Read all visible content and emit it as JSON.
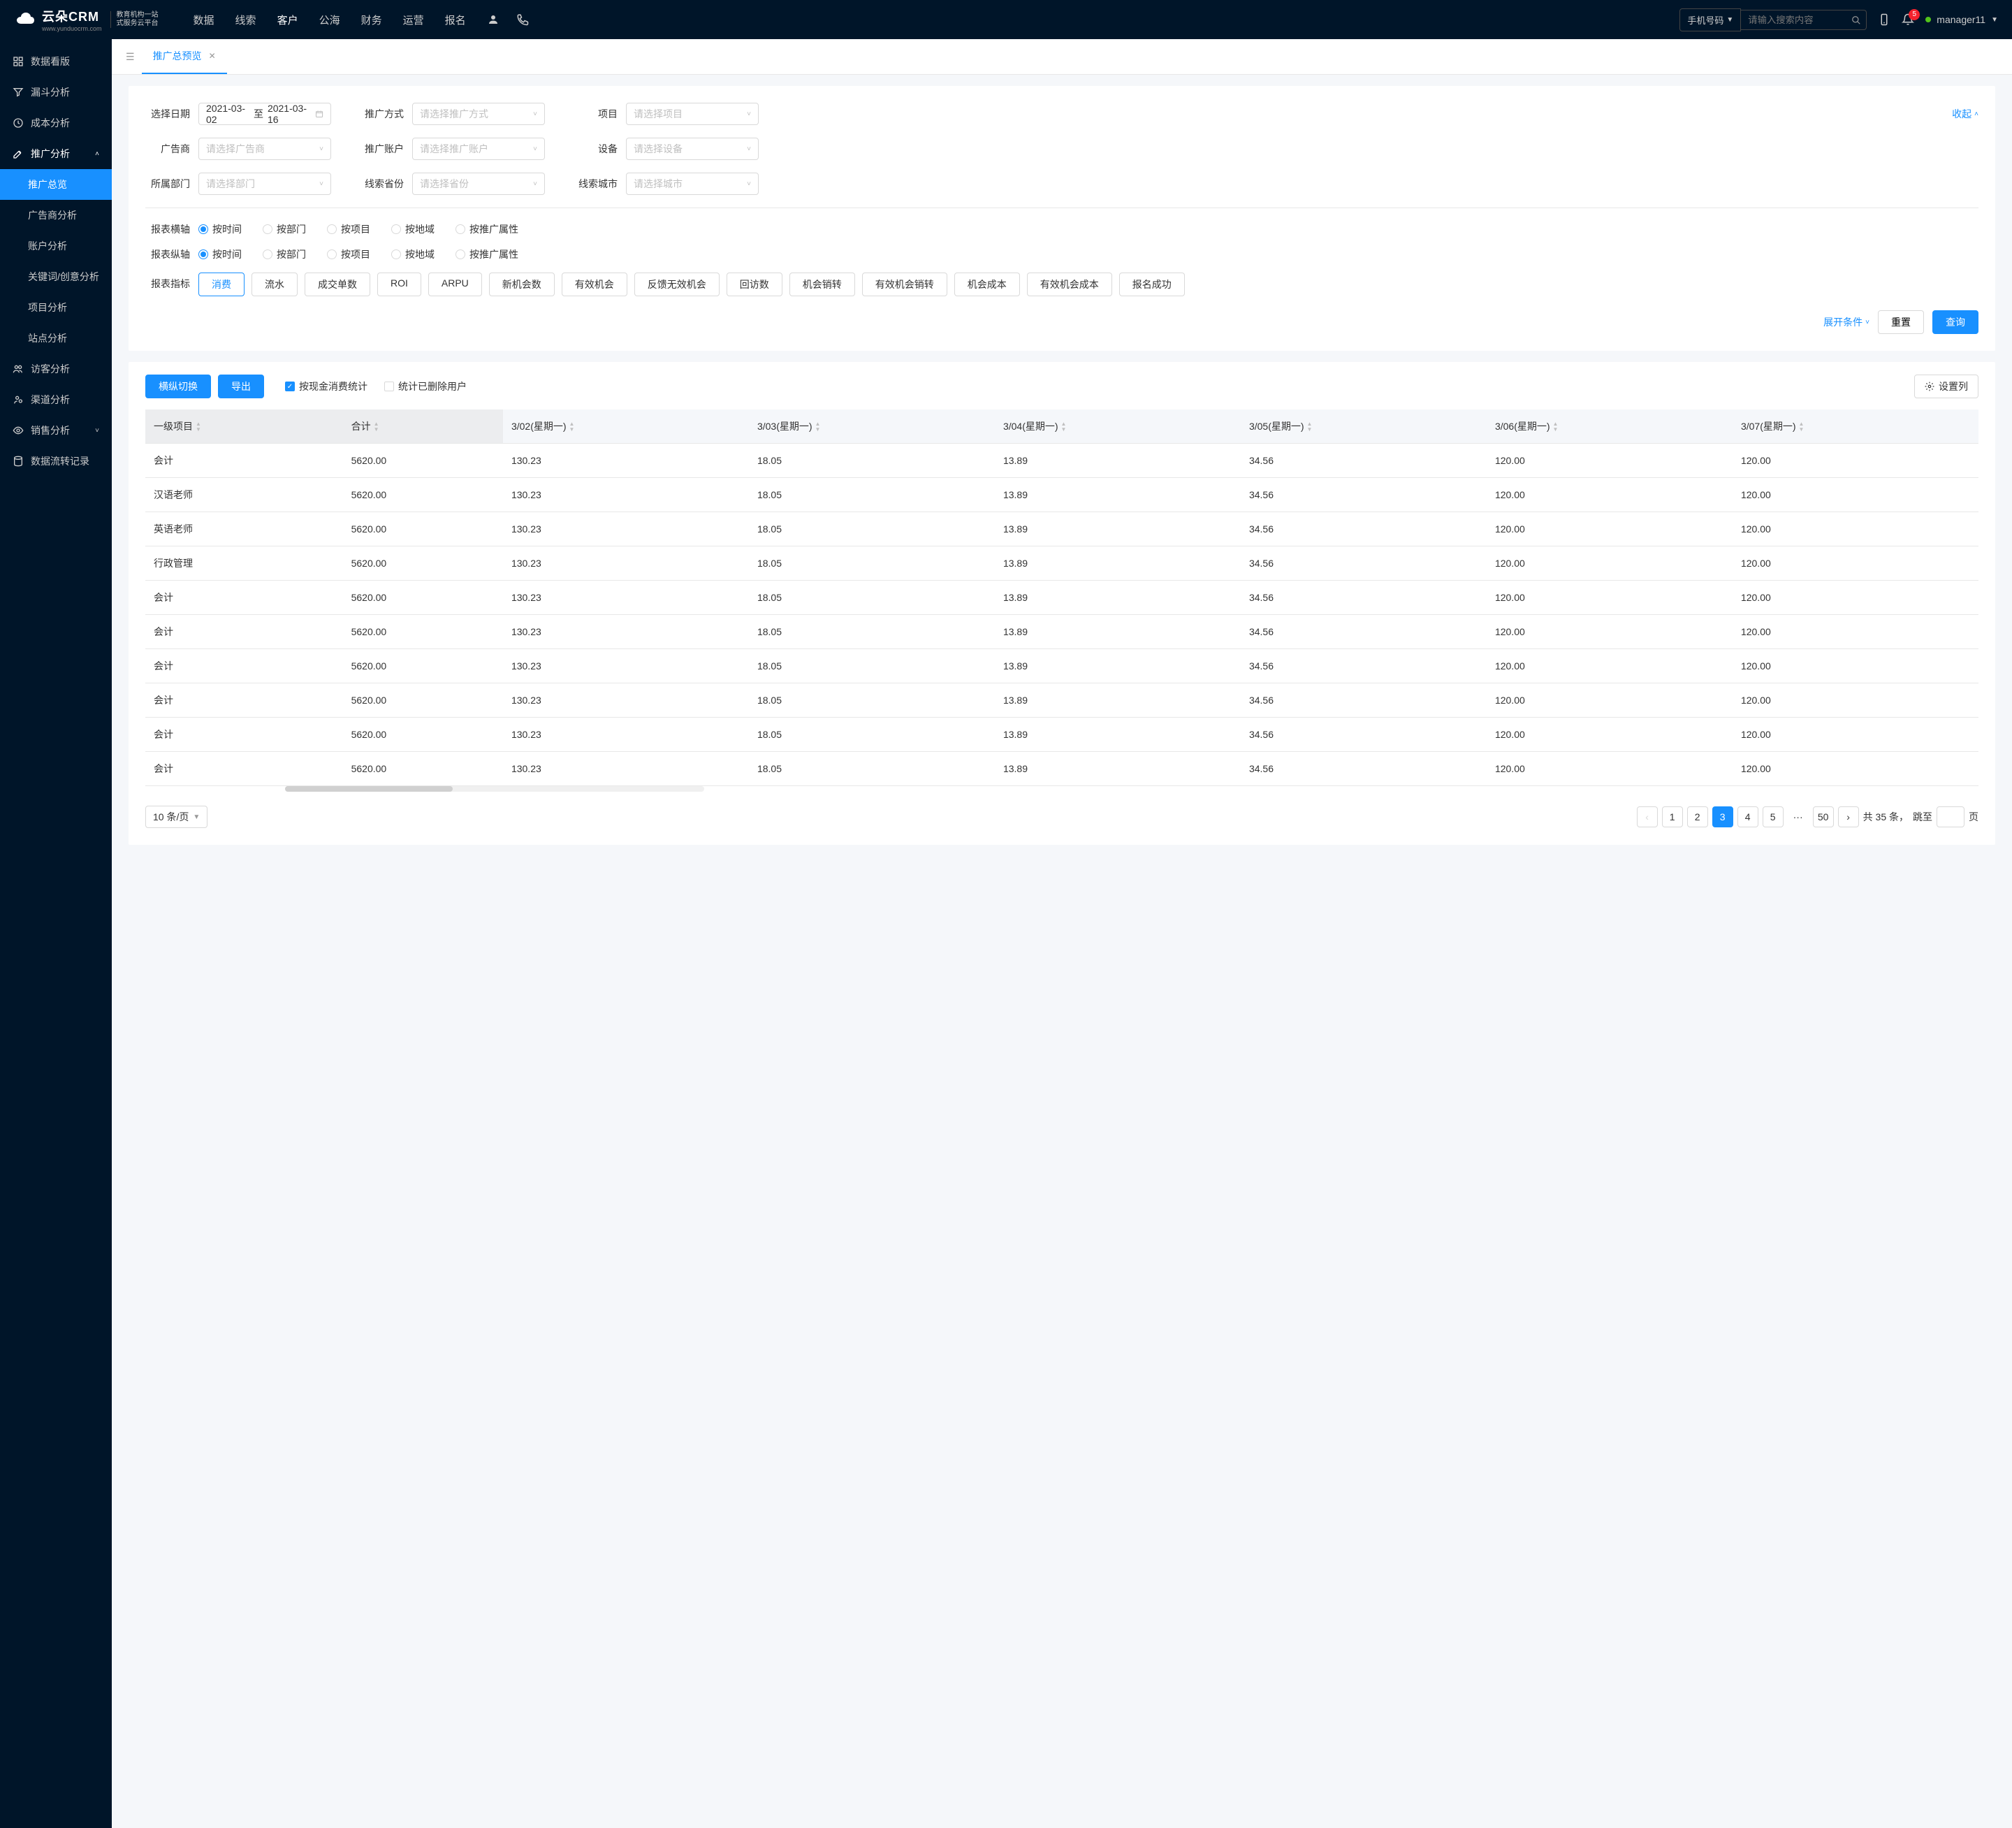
{
  "header": {
    "logo_text": "云朵CRM",
    "logo_sub1": "教育机构一站",
    "logo_sub2": "式服务云平台",
    "logo_url": "www.yunduocrm.com",
    "nav": [
      "数据",
      "线索",
      "客户",
      "公海",
      "财务",
      "运营",
      "报名"
    ],
    "nav_active": 2,
    "search_type": "手机号码",
    "search_placeholder": "请输入搜索内容",
    "badge": "5",
    "user": "manager11"
  },
  "sidebar": [
    {
      "icon": "dashboard",
      "label": "数据看版"
    },
    {
      "icon": "filter",
      "label": "漏斗分析"
    },
    {
      "icon": "clock",
      "label": "成本分析"
    },
    {
      "icon": "edit",
      "label": "推广分析",
      "expanded": true,
      "children": [
        {
          "label": "推广总览",
          "active": true
        },
        {
          "label": "广告商分析"
        },
        {
          "label": "账户分析"
        },
        {
          "label": "关键词/创意分析"
        },
        {
          "label": "项目分析"
        },
        {
          "label": "站点分析"
        }
      ]
    },
    {
      "icon": "group",
      "label": "访客分析"
    },
    {
      "icon": "user",
      "label": "渠道分析"
    },
    {
      "icon": "eye",
      "label": "销售分析",
      "has_arrow": true
    },
    {
      "icon": "db",
      "label": "数据流转记录"
    }
  ],
  "tab": {
    "label": "推广总预览"
  },
  "filters": {
    "date_label": "选择日期",
    "date_from": "2021-03-02",
    "date_sep": "至",
    "date_to": "2021-03-16",
    "row1": [
      {
        "label": "推广方式",
        "placeholder": "请选择推广方式"
      },
      {
        "label": "项目",
        "placeholder": "请选择项目"
      }
    ],
    "row2": [
      {
        "label": "广告商",
        "placeholder": "请选择广告商"
      },
      {
        "label": "推广账户",
        "placeholder": "请选择推广账户"
      },
      {
        "label": "设备",
        "placeholder": "请选择设备"
      }
    ],
    "row3": [
      {
        "label": "所属部门",
        "placeholder": "请选择部门"
      },
      {
        "label": "线索省份",
        "placeholder": "请选择省份"
      },
      {
        "label": "线索城市",
        "placeholder": "请选择城市"
      }
    ],
    "collapse": "收起",
    "axis_h_label": "报表横轴",
    "axis_v_label": "报表纵轴",
    "axis_options": [
      "按时间",
      "按部门",
      "按项目",
      "按地域",
      "按推广属性"
    ],
    "metric_label": "报表指标",
    "metrics": [
      "消费",
      "流水",
      "成交单数",
      "ROI",
      "ARPU",
      "新机会数",
      "有效机会",
      "反馈无效机会",
      "回访数",
      "机会销转",
      "有效机会销转",
      "机会成本",
      "有效机会成本",
      "报名成功"
    ],
    "metric_active": 0,
    "expand": "展开条件",
    "reset": "重置",
    "query": "查询"
  },
  "table": {
    "switch": "横纵切换",
    "export": "导出",
    "check1": "按现金消费统计",
    "check2": "统计已删除用户",
    "col_setting": "设置列",
    "headers": [
      "一级项目",
      "合计",
      "3/02(星期一)",
      "3/03(星期一)",
      "3/04(星期一)",
      "3/05(星期一)",
      "3/06(星期一)",
      "3/07(星期一)"
    ],
    "rows": [
      [
        "会计",
        "5620.00",
        "130.23",
        "18.05",
        "13.89",
        "34.56",
        "120.00",
        "120.00"
      ],
      [
        "汉语老师",
        "5620.00",
        "130.23",
        "18.05",
        "13.89",
        "34.56",
        "120.00",
        "120.00"
      ],
      [
        "英语老师",
        "5620.00",
        "130.23",
        "18.05",
        "13.89",
        "34.56",
        "120.00",
        "120.00"
      ],
      [
        "行政管理",
        "5620.00",
        "130.23",
        "18.05",
        "13.89",
        "34.56",
        "120.00",
        "120.00"
      ],
      [
        "会计",
        "5620.00",
        "130.23",
        "18.05",
        "13.89",
        "34.56",
        "120.00",
        "120.00"
      ],
      [
        "会计",
        "5620.00",
        "130.23",
        "18.05",
        "13.89",
        "34.56",
        "120.00",
        "120.00"
      ],
      [
        "会计",
        "5620.00",
        "130.23",
        "18.05",
        "13.89",
        "34.56",
        "120.00",
        "120.00"
      ],
      [
        "会计",
        "5620.00",
        "130.23",
        "18.05",
        "13.89",
        "34.56",
        "120.00",
        "120.00"
      ],
      [
        "会计",
        "5620.00",
        "130.23",
        "18.05",
        "13.89",
        "34.56",
        "120.00",
        "120.00"
      ],
      [
        "会计",
        "5620.00",
        "130.23",
        "18.05",
        "13.89",
        "34.56",
        "120.00",
        "120.00"
      ]
    ]
  },
  "pagination": {
    "page_size": "10 条/页",
    "pages": [
      "1",
      "2",
      "3",
      "4",
      "5"
    ],
    "active": 2,
    "ellipsis": "···",
    "last": "50",
    "total_prefix": "共 35 条，",
    "jump_label": "跳至",
    "jump_suffix": "页"
  }
}
